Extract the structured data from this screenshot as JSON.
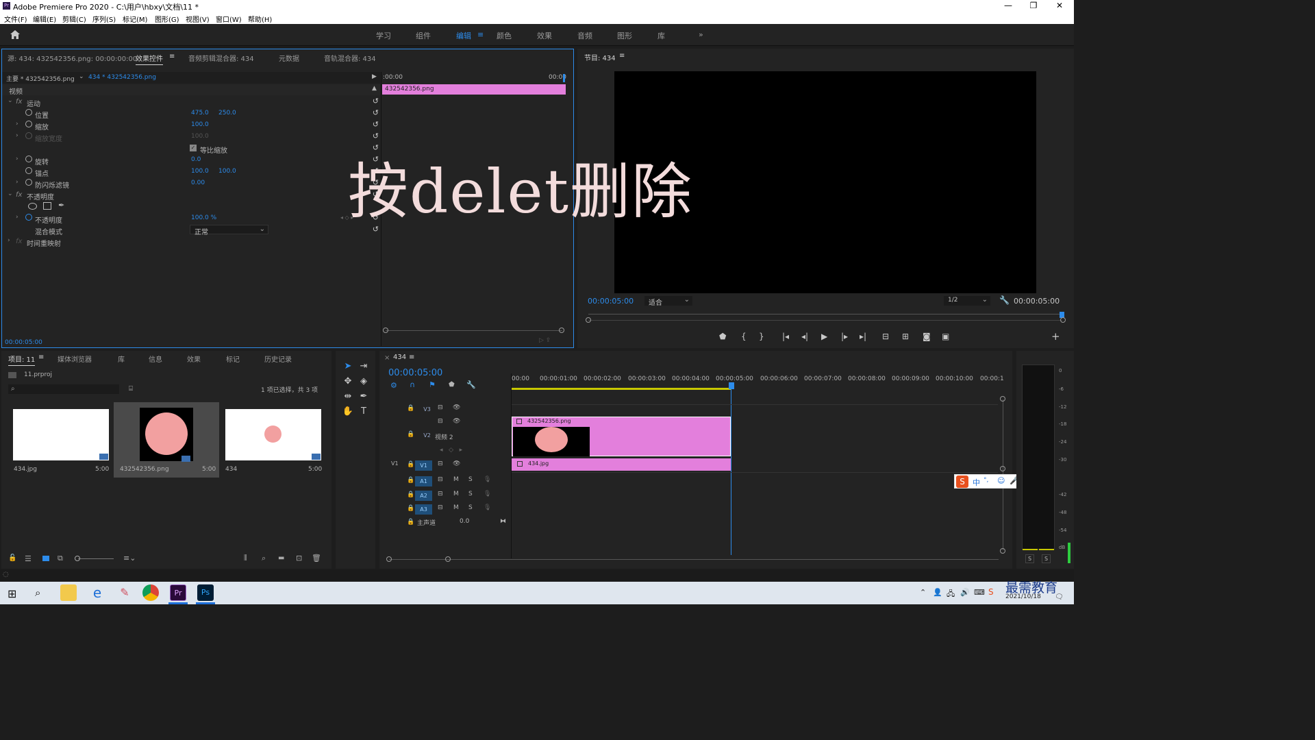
{
  "window": {
    "title": "Adobe Premiere Pro 2020 - C:\\用户\\hbxy\\文档\\11 *",
    "app_icon": "Pr",
    "minimize": "—",
    "maximize": "❐",
    "close": "✕"
  },
  "menu": [
    "文件(F)",
    "编辑(E)",
    "剪辑(C)",
    "序列(S)",
    "标记(M)",
    "图形(G)",
    "视图(V)",
    "窗口(W)",
    "帮助(H)"
  ],
  "workspaces": [
    "学习",
    "组件",
    "编辑",
    "颜色",
    "效果",
    "音频",
    "图形",
    "库"
  ],
  "workspace_active": "编辑",
  "workspace_more": "»",
  "effect_controls": {
    "tabs": [
      "源: 434: 432542356.png: 00:00:00:00",
      "效果控件",
      "音频剪辑混合器: 434",
      "元数据",
      "音轨混合器: 434"
    ],
    "master_label": "主要 * 432542356.png",
    "clip_label": "434 * 432542356.png",
    "video_header": "视频",
    "motion": "运动",
    "position": "位置",
    "position_x": "475.0",
    "position_y": "250.0",
    "scale": "缩放",
    "scale_val": "100.0",
    "scale_width": "缩放宽度",
    "scale_width_val": "100.0",
    "uniform_scale": "等比缩放",
    "rotation": "旋转",
    "rotation_val": "0.0",
    "anchor": "锚点",
    "anchor_x": "100.0",
    "anchor_y": "100.0",
    "anti_flicker": "防闪烁滤镜",
    "anti_flicker_val": "0.00",
    "opacity_group": "不透明度",
    "opacity": "不透明度",
    "opacity_val": "100.0 %",
    "blend_mode": "混合模式",
    "blend_val": "正常",
    "time_remap": "时间重映射",
    "timecode": "00:00:05:00",
    "mini_start": ":00:00",
    "mini_end": "00:00",
    "mini_clip": "432542356.png"
  },
  "overlay_text": "按delet删除",
  "program": {
    "title": "节目: 434",
    "timecode_left": "00:00:05:00",
    "fit": "适合",
    "resolution": "1/2",
    "timecode_right": "00:00:05:00"
  },
  "project": {
    "tabs": [
      "项目: 11",
      "媒体浏览器",
      "库",
      "信息",
      "效果",
      "标记",
      "历史记录"
    ],
    "file": "11.prproj",
    "selection_info": "1 项已选择，共 3 项",
    "items": [
      {
        "name": "434.jpg",
        "duration": "5:00"
      },
      {
        "name": "432542356.png",
        "duration": "5:00"
      },
      {
        "name": "434",
        "duration": "5:00"
      }
    ]
  },
  "timeline": {
    "seq_name": "434",
    "timecode": "00:00:05:00",
    "ruler": [
      "00:00",
      "00:00:01:00",
      "00:00:02:00",
      "00:00:03:00",
      "00:00:04:00",
      "00:00:05:00",
      "00:00:06:00",
      "00:00:07:00",
      "00:00:08:00",
      "00:00:09:00",
      "00:00:10:00",
      "00:00:1"
    ],
    "tracks": {
      "v3": "V3",
      "v2": "V2",
      "v2_name": "视频 2",
      "v1_src": "V1",
      "v1": "V1",
      "a1": "A1",
      "a2": "A2",
      "a3": "A3",
      "master": "主声道",
      "master_val": "0.0",
      "mute": "M",
      "solo": "S"
    },
    "clip_v2": "432542356.png",
    "clip_v1": "434.jpg"
  },
  "meter": {
    "ticks": [
      "0",
      "-6",
      "-12",
      "-18",
      "-24",
      "-30",
      "-36",
      "-42",
      "-48",
      "-54",
      "dB"
    ],
    "solo_left": "S",
    "solo_right": "S"
  },
  "ime": {
    "mode": "中",
    "punct": "°,"
  },
  "taskbar": {
    "date": "2021/10/18",
    "watermark": "最需教育",
    "pr_label": "Pr",
    "ps_label": "Ps"
  },
  "colors": {
    "accent": "#2d8ceb",
    "clip_pink": "#e37fdc",
    "circle": "#f2a0a0"
  }
}
